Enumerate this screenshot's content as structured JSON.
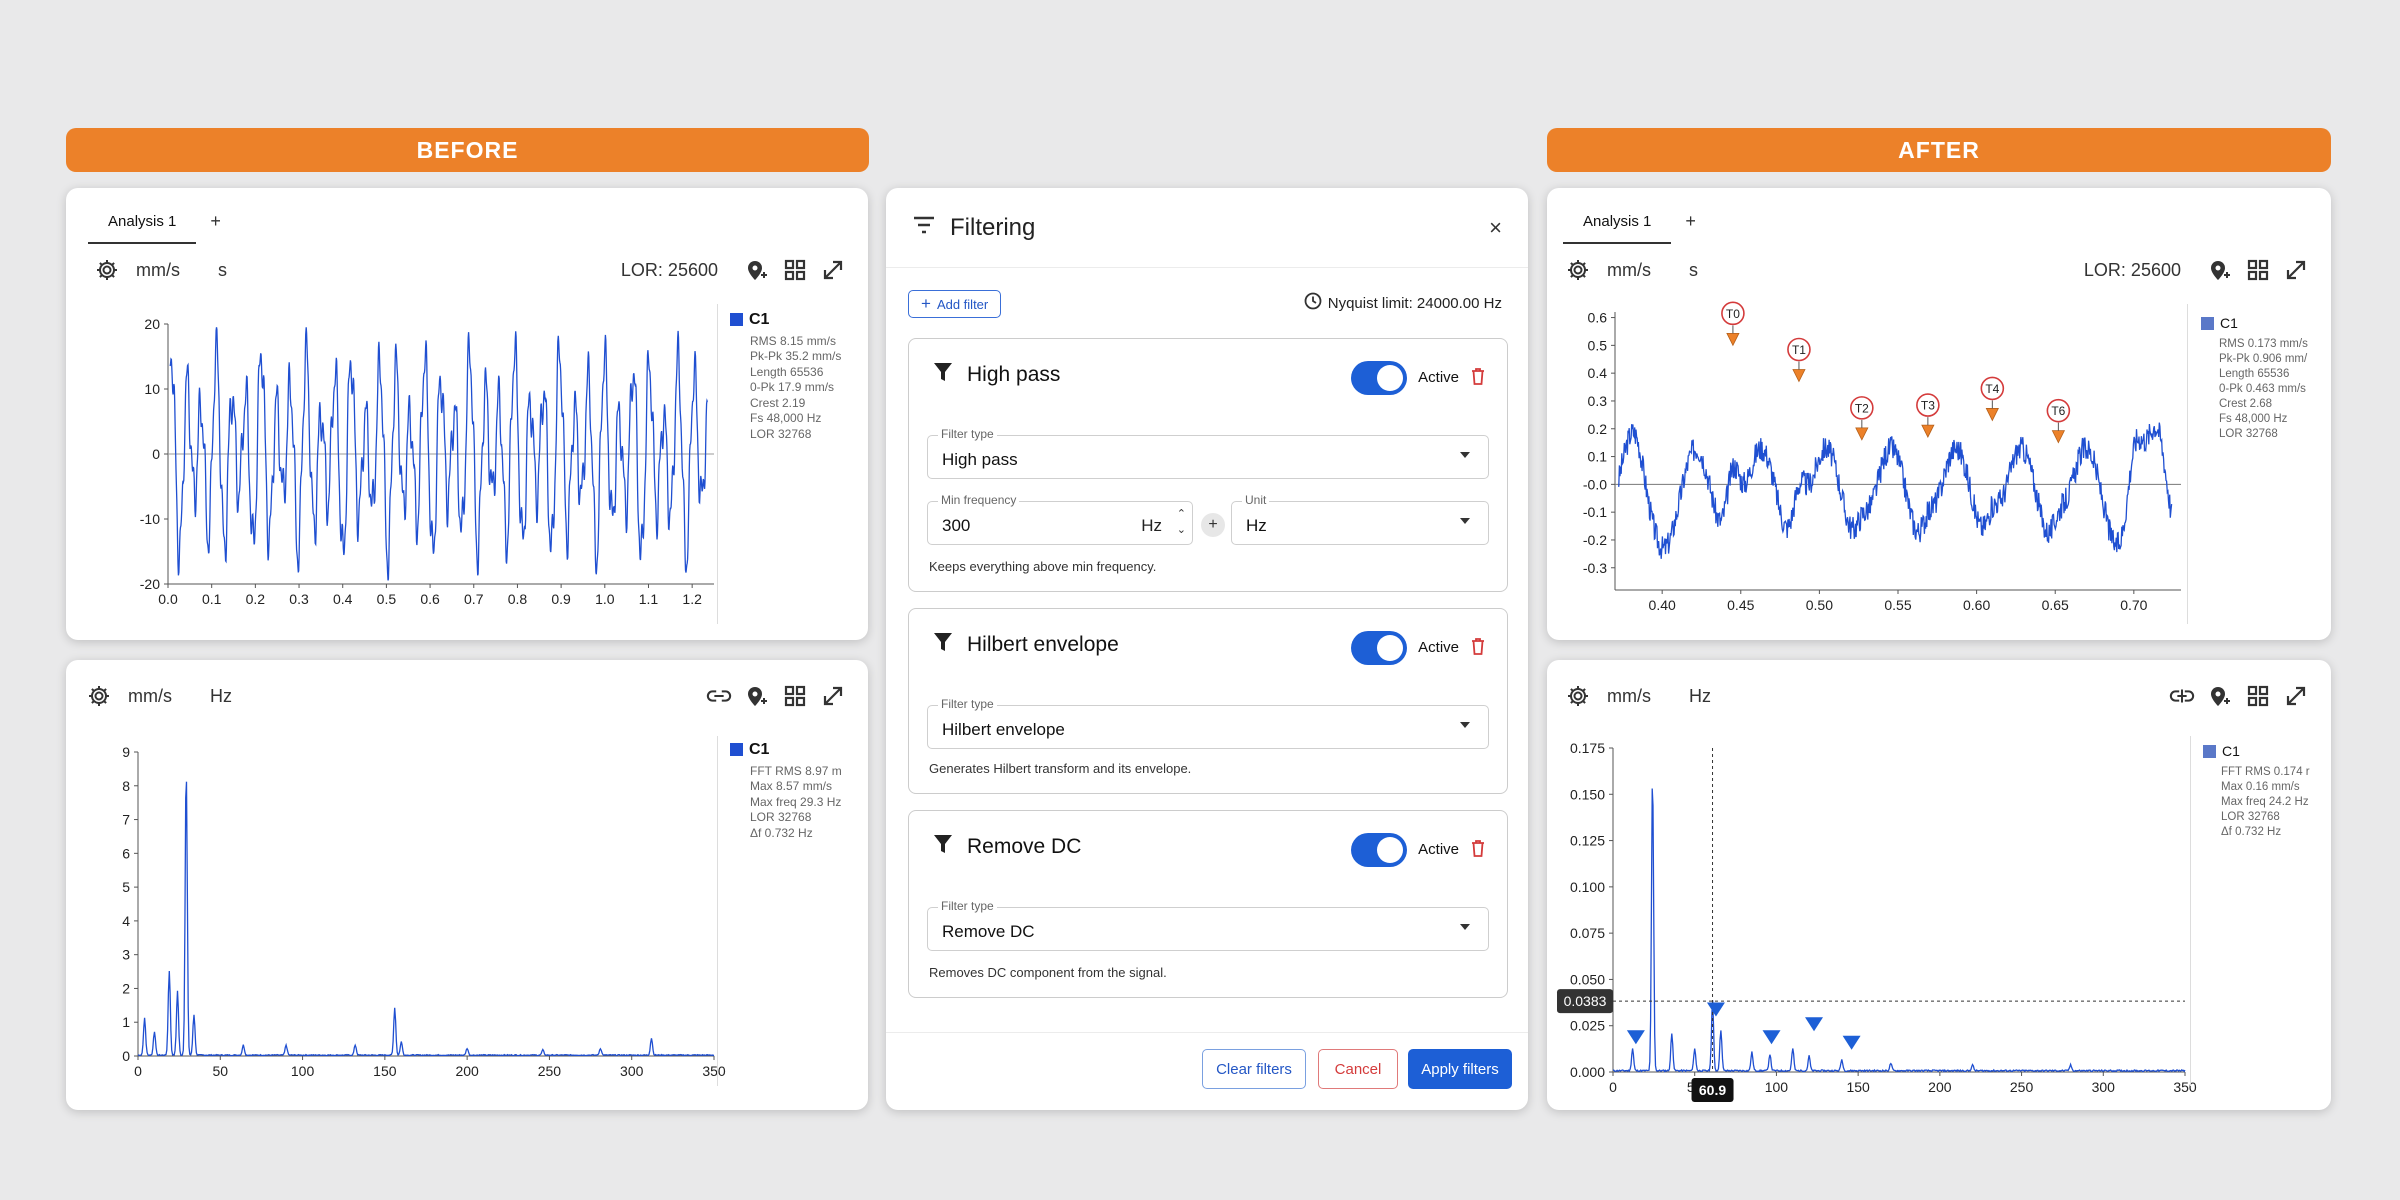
{
  "banners": {
    "before": "BEFORE",
    "after": "AFTER"
  },
  "before_time": {
    "tab": "Analysis 1",
    "add_tab": "+",
    "unit_y": "mm/s",
    "unit_x": "s",
    "lor_label": "LOR: 25600",
    "legend": {
      "name": "C1",
      "lines": [
        "RMS 8.15 mm/s",
        "Pk-Pk 35.2 mm/s",
        "Length 65536",
        "0-Pk 17.9 mm/s",
        "Crest 2.19",
        "Fs 48,000 Hz",
        "LOR 32768"
      ]
    }
  },
  "before_fft": {
    "unit_y": "mm/s",
    "unit_x": "Hz",
    "legend": {
      "name": "C1",
      "lines": [
        "FFT RMS 8.97 m",
        "Max 8.57 mm/s",
        "Max freq 29.3 Hz",
        "LOR 32768",
        "Δf 0.732 Hz"
      ]
    }
  },
  "after_time": {
    "tab": "Analysis 1",
    "add_tab": "+",
    "unit_y": "mm/s",
    "unit_x": "s",
    "lor_label": "LOR: 25600",
    "legend": {
      "name": "C1",
      "lines": [
        "RMS 0.173 mm/s",
        "Pk-Pk 0.906 mm/",
        "Length 65536",
        "0-Pk 0.463 mm/s",
        "Crest 2.68",
        "Fs 48,000 Hz",
        "LOR 32768"
      ]
    }
  },
  "after_fft": {
    "unit_y": "mm/s",
    "unit_x": "Hz",
    "cursor_y": "0.0383",
    "cursor_x": "60.9",
    "legend": {
      "name": "C1",
      "lines": [
        "FFT RMS 0.174 r",
        "Max 0.16 mm/s",
        "Max freq 24.2 Hz",
        "LOR 32768",
        "Δf 0.732 Hz"
      ]
    }
  },
  "dialog": {
    "title": "Filtering",
    "close": "×",
    "add_filter": "Add filter",
    "nyquist": "Nyquist limit: 24000.00 Hz",
    "filters": [
      {
        "name": "High pass",
        "active": "Active",
        "type_label": "Filter type",
        "type_value": "High pass",
        "min_label": "Min frequency",
        "min_value": "300",
        "min_unit": "Hz",
        "unit_label": "Unit",
        "unit_value": "Hz",
        "hint": "Keeps everything above min frequency."
      },
      {
        "name": "Hilbert envelope",
        "active": "Active",
        "type_label": "Filter type",
        "type_value": "Hilbert envelope",
        "hint": "Generates Hilbert transform and its envelope."
      },
      {
        "name": "Remove DC",
        "active": "Active",
        "type_label": "Filter type",
        "type_value": "Remove DC",
        "hint": "Removes DC component from the signal."
      }
    ],
    "buttons": {
      "clear": "Clear filters",
      "cancel": "Cancel",
      "apply": "Apply filters"
    }
  },
  "colors": {
    "accent": "#ec8129",
    "primary": "#1d5fd6",
    "trace": "#1f4fd1",
    "danger": "#d43b3b"
  },
  "chart_data": [
    {
      "id": "before_time",
      "type": "line",
      "xlabel": "",
      "ylabel": "",
      "xlim": [
        0,
        1.25
      ],
      "ylim": [
        -20,
        20
      ],
      "xticks": [
        0.0,
        0.1,
        0.2,
        0.3,
        0.4,
        0.5,
        0.6,
        0.7,
        0.8,
        0.9,
        1.0,
        1.1,
        1.2
      ],
      "yticks": [
        20,
        10,
        0,
        -10,
        -20
      ],
      "series": [
        {
          "name": "C1",
          "pattern": "oscillating signal of roughly ±17 mm/s peak around 0"
        }
      ]
    },
    {
      "id": "before_fft",
      "type": "line",
      "xlim": [
        0,
        350
      ],
      "ylim": [
        0,
        9
      ],
      "xticks": [
        0,
        50,
        100,
        150,
        200,
        250,
        300,
        350
      ],
      "yticks": [
        9,
        8,
        7,
        6,
        5,
        4,
        3,
        2,
        1,
        0
      ],
      "peaks": [
        [
          4,
          1.1
        ],
        [
          10,
          0.7
        ],
        [
          19,
          2.5
        ],
        [
          24,
          1.9
        ],
        [
          29.3,
          8.5
        ],
        [
          34,
          1.2
        ],
        [
          64,
          0.3
        ],
        [
          90,
          0.3
        ],
        [
          132,
          0.3
        ],
        [
          156,
          1.4
        ],
        [
          160,
          0.4
        ],
        [
          200,
          0.2
        ],
        [
          246,
          0.15
        ],
        [
          281,
          0.2
        ],
        [
          312,
          0.5
        ]
      ]
    },
    {
      "id": "after_time",
      "type": "line",
      "xlim": [
        0.37,
        0.73
      ],
      "ylim": [
        -0.38,
        0.62
      ],
      "xticks": [
        0.4,
        0.45,
        0.5,
        0.55,
        0.6,
        0.65,
        0.7
      ],
      "yticks": [
        0.6,
        0.5,
        0.4,
        0.3,
        0.2,
        0.1,
        -0.0,
        -0.1,
        -0.2,
        -0.3
      ],
      "ytick_labels": [
        "0.6",
        "0.5",
        "0.4",
        "0.3",
        "0.2",
        "0.1",
        "-0.0",
        "-0.1",
        "-0.2",
        "-0.3"
      ],
      "markers": [
        {
          "label": "T0",
          "x": 0.445,
          "y": 0.5
        },
        {
          "label": "T1",
          "x": 0.487,
          "y": 0.37
        },
        {
          "label": "T2",
          "x": 0.527,
          "y": 0.16
        },
        {
          "label": "T3",
          "x": 0.569,
          "y": 0.17
        },
        {
          "label": "T4",
          "x": 0.61,
          "y": 0.23
        },
        {
          "label": "T6",
          "x": 0.652,
          "y": 0.15
        }
      ]
    },
    {
      "id": "after_fft",
      "type": "line",
      "xlim": [
        0,
        350
      ],
      "ylim": [
        0,
        0.175
      ],
      "xticks": [
        0,
        50,
        100,
        150,
        200,
        250,
        300,
        350
      ],
      "yticks": [
        0.175,
        0.15,
        0.125,
        0.1,
        0.075,
        0.05,
        0.025,
        0.0
      ],
      "ytick_labels": [
        "0.175",
        "0.150",
        "0.125",
        "0.100",
        "0.075",
        "0.050",
        "0.025",
        "0.000"
      ],
      "peaks": [
        [
          12,
          0.012
        ],
        [
          24.2,
          0.16
        ],
        [
          36,
          0.02
        ],
        [
          50,
          0.012
        ],
        [
          60.9,
          0.0383
        ],
        [
          66,
          0.022
        ],
        [
          85,
          0.01
        ],
        [
          96,
          0.009
        ],
        [
          110,
          0.012
        ],
        [
          120,
          0.008
        ],
        [
          140,
          0.006
        ],
        [
          170,
          0.004
        ],
        [
          220,
          0.003
        ],
        [
          280,
          0.003
        ]
      ],
      "markers": [
        [
          14,
          0.015
        ],
        [
          63,
          0.03
        ],
        [
          97,
          0.015
        ],
        [
          123,
          0.022
        ],
        [
          146,
          0.012
        ]
      ],
      "cursor": {
        "x": 60.9,
        "y": 0.0383
      }
    }
  ]
}
